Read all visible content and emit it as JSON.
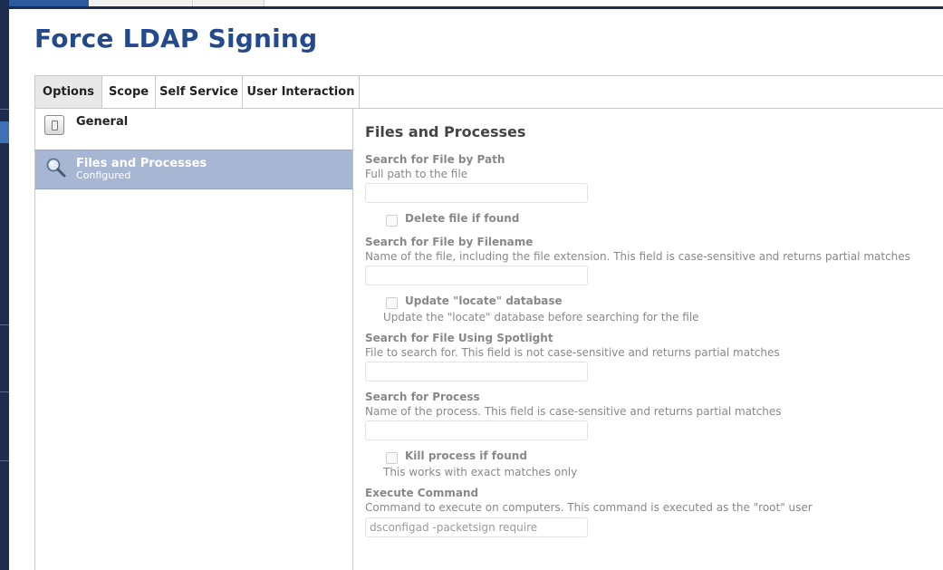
{
  "page": {
    "title": "Force LDAP Signing"
  },
  "tabs": [
    {
      "label": "Options"
    },
    {
      "label": "Scope"
    },
    {
      "label": "Self Service"
    },
    {
      "label": "User Interaction"
    }
  ],
  "sidebar": {
    "items": [
      {
        "label": "General",
        "icon": "switch-icon"
      },
      {
        "label": "Files and Processes",
        "status": "Configured",
        "icon": "magnifier-icon"
      }
    ]
  },
  "section": {
    "title": "Files and Processes",
    "path": {
      "label": "Search for File by Path",
      "help": "Full path to the file",
      "value": "",
      "checkbox": {
        "label": "Delete file if found",
        "checked": false
      }
    },
    "filename": {
      "label": "Search for File by Filename",
      "help": "Name of the file, including the file extension. This field is case-sensitive and returns partial matches",
      "value": "",
      "checkbox": {
        "label": "Update \"locate\" database",
        "checked": false,
        "help": "Update the \"locate\" database before searching for the file"
      }
    },
    "spotlight": {
      "label": "Search for File Using Spotlight",
      "help": "File to search for. This field is not case-sensitive and returns partial matches",
      "value": ""
    },
    "process": {
      "label": "Search for Process",
      "help": "Name of the process. This field is case-sensitive and returns partial matches",
      "value": "",
      "checkbox": {
        "label": "Kill process if found",
        "checked": false,
        "help": "This works with exact matches only"
      }
    },
    "command": {
      "label": "Execute Command",
      "help": "Command to execute on computers. This command is executed as the \"root\" user",
      "value": "dsconfigad -packetsign require"
    }
  },
  "colors": {
    "title": "#254a8c",
    "nav": "#1d2d4f",
    "selected_item": "#a7b7d3"
  }
}
